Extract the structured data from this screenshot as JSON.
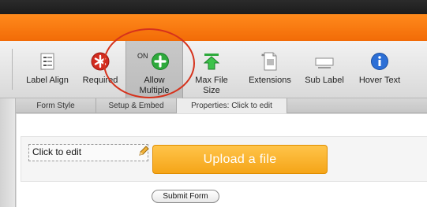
{
  "toolbar": {
    "items": [
      {
        "label": "Label Align",
        "icon": "label-align-icon"
      },
      {
        "label": "Required",
        "icon": "required-icon"
      },
      {
        "label": "Allow\nMultiple",
        "icon": "add-circle-icon",
        "state": "ON"
      },
      {
        "label": "Max File\nSize",
        "icon": "upload-arrow-icon"
      },
      {
        "label": "Extensions",
        "icon": "file-icon"
      },
      {
        "label": "Sub Label",
        "icon": "sublabel-icon"
      },
      {
        "label": "Hover Text",
        "icon": "info-icon"
      }
    ]
  },
  "tabs": {
    "form_style": "Form Style",
    "setup_embed": "Setup & Embed",
    "properties": "Properties: Click to edit"
  },
  "form": {
    "field_label": "Click to edit",
    "upload_button": "Upload a file",
    "submit_button": "Submit Form"
  },
  "colors": {
    "accent_orange": "#f26b07",
    "upload_button": "#f5a518",
    "highlight_ring": "#d6321c",
    "add_green": "#2eaa3c",
    "info_blue": "#2c6fd6",
    "required_red": "#d22b1f"
  }
}
